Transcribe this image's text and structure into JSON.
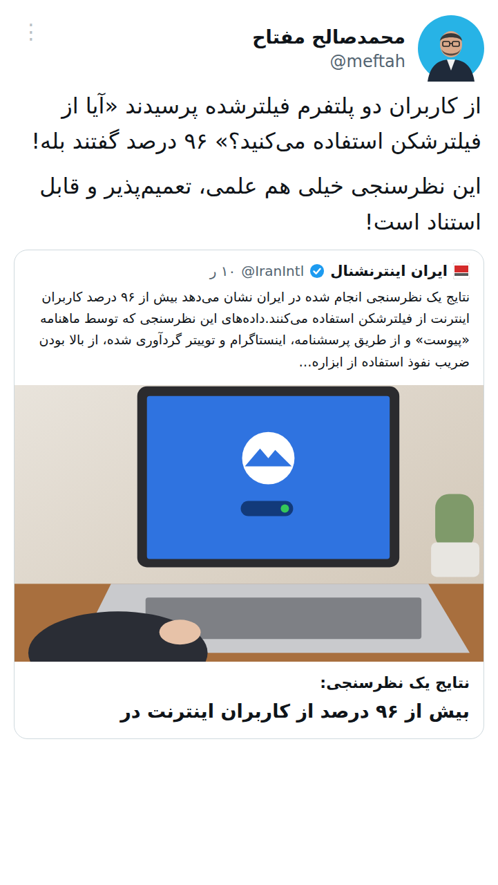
{
  "tweet": {
    "author": {
      "name": "محمدصالح مفتاح",
      "handle": "@meftah"
    },
    "menu_icon": "⋮",
    "paragraphs": [
      "از کاربران دو پلتفرم فیلترشده پرسیدند «آیا از فیلترشکن استفاده می‌کنید؟» ۹۶ درصد گفتند بله!",
      "این نظرسنجی خیلی هم علمی، تعمیم‌پذیر و قابل استناد است!"
    ]
  },
  "quote": {
    "author": {
      "name": "ایران اینترنشنال",
      "verified": true,
      "handle": "@IranIntl",
      "time": "۱۰ ر"
    },
    "text": "نتایج یک نظرسنجی انجام شده در ایران نشان می‌دهد بیش از ۹۶ درصد کاربران اینترنت از فیلترشکن استفاده می‌کنند.داده‌های این نظرسنجی که توسط ماهنامه «پیوست» و از طریق پرسشنامه، اینستاگرام و توییتر گردآوری شده، از بالا بودن ضریب نفوذ استفاده از ابزاره…",
    "link_card": {
      "kicker": "نتایج یک نظرسنجی:",
      "headline": "بیش از ۹۶ درصد از کاربران اینترنت در"
    }
  }
}
